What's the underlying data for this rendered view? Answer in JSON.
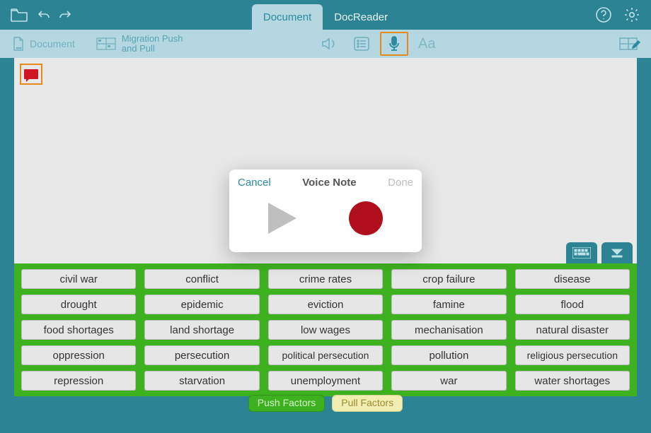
{
  "topbar": {
    "tabs": [
      {
        "label": "Document",
        "active": true
      },
      {
        "label": "DocReader",
        "active": false
      }
    ]
  },
  "subbar": {
    "crumb1": "Document",
    "crumb2_line1": "Migration Push",
    "crumb2_line2": "and Pull",
    "font_label": "Aa"
  },
  "modal": {
    "cancel": "Cancel",
    "title": "Voice Note",
    "done": "Done"
  },
  "bank": {
    "words": [
      "civil war",
      "conflict",
      "crime rates",
      "crop failure",
      "disease",
      "drought",
      "epidemic",
      "eviction",
      "famine",
      "flood",
      "food shortages",
      "land shortage",
      "low wages",
      "mechanisation",
      "natural disaster",
      "oppression",
      "persecution",
      "political persecution",
      "pollution",
      "religious persecution",
      "repression",
      "starvation",
      "unemployment",
      "war",
      "water shortages"
    ],
    "tabs": {
      "push": "Push Factors",
      "pull": "Pull Factors"
    }
  },
  "colors": {
    "accent": "#2b8393",
    "highlight": "#e88a1a",
    "bank": "#3db120"
  }
}
